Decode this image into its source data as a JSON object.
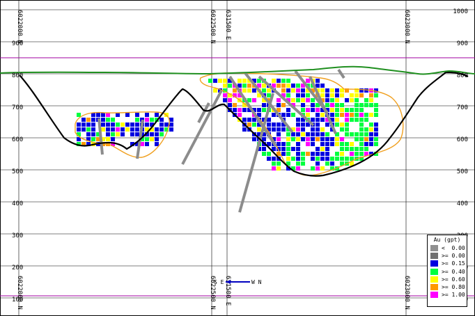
{
  "elevation_labels": [
    "1000",
    "900",
    "800",
    "700",
    "600",
    "500",
    "400",
    "300",
    "200",
    "100"
  ],
  "grid_labels_top": [
    "6022000 N",
    "6022500 N",
    "631500 E",
    "6023000 N"
  ],
  "grid_labels_bottom": [
    "6022000 N",
    "6022500 N",
    "631500 E",
    "6023000 N"
  ],
  "azimuth_indicator": {
    "left_label": "S E",
    "right_label": "W N",
    "color": "#0000c0"
  },
  "legend": {
    "title": "Au (gpt)",
    "entries": [
      {
        "label": "<  0.00",
        "color": "#909090"
      },
      {
        "label": ">= 0.00",
        "color": "#707070"
      },
      {
        "label": ">= 0.15",
        "color": "#0000e0"
      },
      {
        "label": ">= 0.40",
        "color": "#00ff40"
      },
      {
        "label": ">= 0.60",
        "color": "#ffff00"
      },
      {
        "label": ">= 0.80",
        "color": "#ff9900"
      },
      {
        "label": ">= 1.00",
        "color": "#ff00ff"
      }
    ]
  },
  "colors": {
    "topography": "#1f8f1f",
    "pit_outline": "#000000",
    "resource_shell": "#f0a020",
    "drillhole": "#8c8c8c",
    "reference_line": "#a000a0"
  }
}
